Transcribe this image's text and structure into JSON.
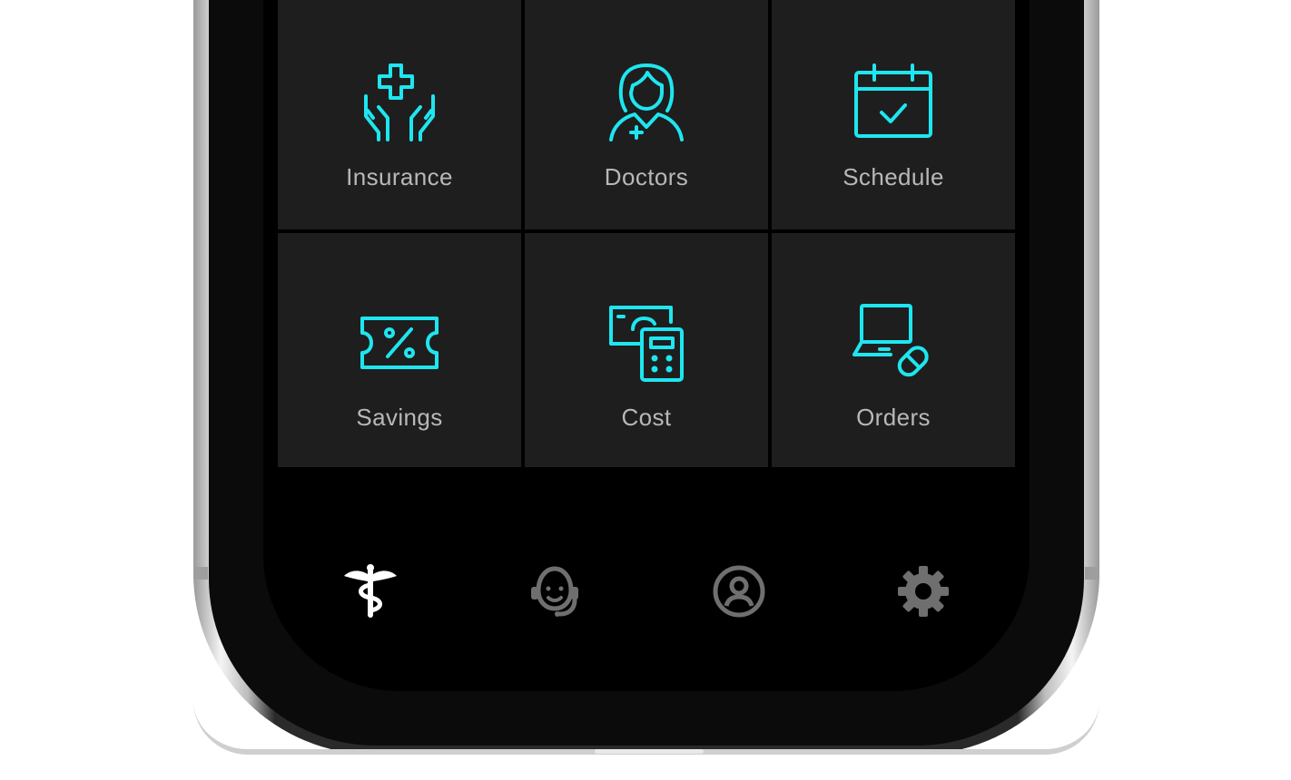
{
  "colors": {
    "accent": "#1ee6f0",
    "tile_bg": "#1e1e1e",
    "label": "#b8b8b8",
    "nav_active": "#ffffff",
    "nav_inactive": "#6f6f6f"
  },
  "tiles": [
    {
      "label": "Insurance",
      "icon": "insurance-hands-cross-icon"
    },
    {
      "label": "Doctors",
      "icon": "doctor-icon"
    },
    {
      "label": "Schedule",
      "icon": "calendar-check-icon"
    },
    {
      "label": "Savings",
      "icon": "percent-ticket-icon"
    },
    {
      "label": "Cost",
      "icon": "cash-calculator-icon"
    },
    {
      "label": "Orders",
      "icon": "laptop-pill-icon"
    }
  ],
  "bottom_nav": [
    {
      "icon": "caduceus-icon",
      "active": true
    },
    {
      "icon": "support-agent-icon",
      "active": false
    },
    {
      "icon": "profile-icon",
      "active": false
    },
    {
      "icon": "gear-icon",
      "active": false
    }
  ]
}
